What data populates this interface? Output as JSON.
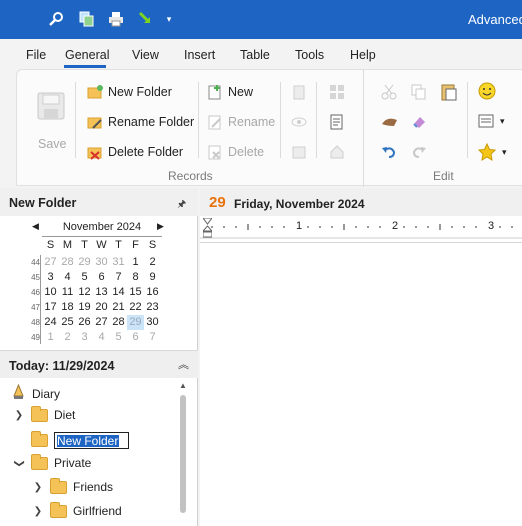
{
  "titlebar": {
    "app_title": "Advanced"
  },
  "menu": {
    "items": [
      "File",
      "General",
      "View",
      "Insert",
      "Table",
      "Tools",
      "Help"
    ]
  },
  "ribbon": {
    "save_label": "Save",
    "new_folder": "New Folder",
    "rename_folder": "Rename Folder",
    "delete_folder": "Delete Folder",
    "new": "New",
    "rename": "Rename",
    "delete": "Delete",
    "records_group": "Records",
    "edit_group": "Edit"
  },
  "left_pane": {
    "header": "New Folder",
    "today_header": "Today: 11/29/2024"
  },
  "calendar": {
    "month": "November 2024",
    "weekdays": [
      "S",
      "M",
      "T",
      "W",
      "T",
      "F",
      "S"
    ],
    "weeks": [
      {
        "num": "44",
        "days": [
          "27",
          "28",
          "29",
          "30",
          "31",
          "1",
          "2"
        ]
      },
      {
        "num": "45",
        "days": [
          "3",
          "4",
          "5",
          "6",
          "7",
          "8",
          "9"
        ]
      },
      {
        "num": "46",
        "days": [
          "10",
          "11",
          "12",
          "13",
          "14",
          "15",
          "16"
        ]
      },
      {
        "num": "47",
        "days": [
          "17",
          "18",
          "19",
          "20",
          "21",
          "22",
          "23"
        ]
      },
      {
        "num": "48",
        "days": [
          "24",
          "25",
          "26",
          "27",
          "28",
          "29",
          "30"
        ]
      },
      {
        "num": "49",
        "days": [
          "1",
          "2",
          "3",
          "4",
          "5",
          "6",
          "7"
        ]
      }
    ],
    "selected_day": "29"
  },
  "tree": {
    "items": [
      {
        "label": "Diary"
      },
      {
        "label": "Diet"
      },
      {
        "label": "New Folder",
        "editing": true
      },
      {
        "label": "Private"
      },
      {
        "label": "Friends"
      },
      {
        "label": "Girlfriend"
      }
    ]
  },
  "main": {
    "day_number": "29",
    "date_text": "Friday, November 2024",
    "ruler_marks": [
      "1",
      "2",
      "3"
    ]
  },
  "colors": {
    "accent": "#1e64c3",
    "date_orange": "#e8730d",
    "selection": "#cce4f7"
  }
}
